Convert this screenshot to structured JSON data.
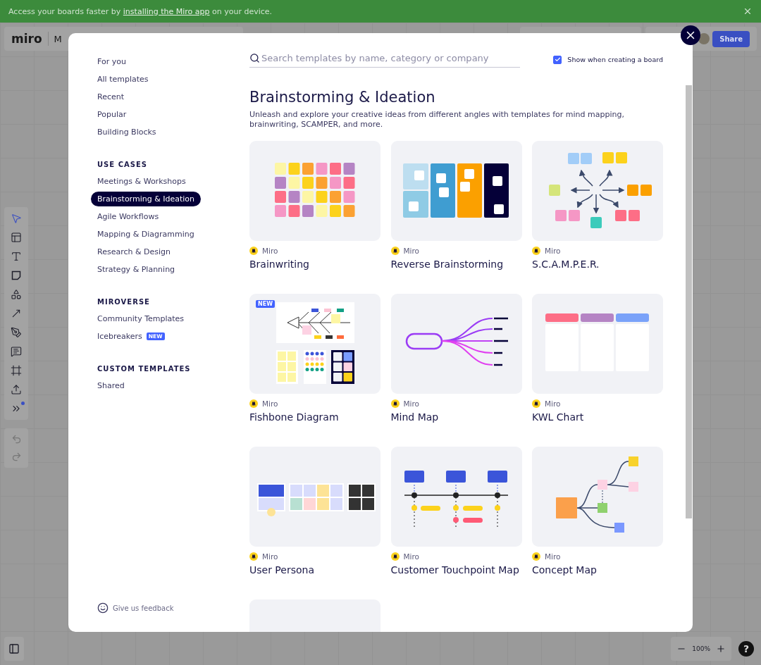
{
  "banner": {
    "text": "Access your boards faster by ",
    "link": "installing the Miro app",
    "text_end": " on your device."
  },
  "board": {
    "logo": "miro",
    "name": "M",
    "share": "Share",
    "zoom": "100%",
    "help": "?",
    "tools": [
      {
        "kind": "select",
        "selected": true
      },
      {
        "kind": "templates",
        "selected": false
      },
      {
        "kind": "text",
        "selected": false
      },
      {
        "kind": "sticky",
        "selected": false
      },
      {
        "kind": "shapes",
        "selected": false
      },
      {
        "kind": "line",
        "selected": false
      },
      {
        "kind": "pen",
        "selected": false
      },
      {
        "kind": "comment",
        "selected": false
      },
      {
        "kind": "frame",
        "selected": false
      },
      {
        "kind": "upload",
        "selected": false
      },
      {
        "kind": "more",
        "selected": false,
        "dot": true
      }
    ]
  },
  "modal": {
    "sidebar": {
      "items": [
        {
          "label": "For you",
          "selected": false
        },
        {
          "label": "All templates",
          "selected": false
        },
        {
          "label": "Recent",
          "selected": false
        },
        {
          "label": "Popular",
          "selected": false
        },
        {
          "label": "Building Blocks",
          "selected": false
        }
      ],
      "sections": [
        {
          "heading": "USE CASES",
          "items": [
            {
              "label": "Meetings & Workshops",
              "selected": false
            },
            {
              "label": "Brainstorming & Ideation",
              "selected": true
            },
            {
              "label": "Agile Workflows",
              "selected": false
            },
            {
              "label": "Mapping & Diagramming",
              "selected": false
            },
            {
              "label": "Research & Design",
              "selected": false
            },
            {
              "label": "Strategy & Planning",
              "selected": false
            }
          ]
        },
        {
          "heading": "MIROVERSE",
          "items": [
            {
              "label": "Community Templates",
              "selected": false
            },
            {
              "label": "Icebreakers",
              "selected": false,
              "badge": "NEW"
            }
          ]
        },
        {
          "heading": "CUSTOM TEMPLATES",
          "items": [
            {
              "label": "Shared",
              "selected": false
            }
          ]
        }
      ],
      "feedback": "Give us feedback"
    },
    "search": {
      "placeholder": "Search templates by name, category or company"
    },
    "show_when_creating": {
      "label": "Show when creating a board",
      "checked": true
    },
    "title": "Brainstorming & Ideation",
    "description": "Unleash and explore your creative ideas from different angles with templates for mind mapping, brainwriting, SCAMPER, and more.",
    "templates": [
      {
        "kind": "grid",
        "author": "Miro",
        "title": "Brainwriting"
      },
      {
        "kind": "columns",
        "author": "Miro",
        "title": "Reverse Brainstorming"
      },
      {
        "kind": "scamper",
        "author": "Miro",
        "title": "S.C.A.M.P.E.R."
      },
      {
        "kind": "fishbone",
        "author": "Miro",
        "title": "Fishbone Diagram",
        "badge": "NEW"
      },
      {
        "kind": "mindmap",
        "author": "Miro",
        "title": "Mind Map"
      },
      {
        "kind": "kwl",
        "author": "Miro",
        "title": "KWL Chart"
      },
      {
        "kind": "persona",
        "author": "Miro",
        "title": "User Persona"
      },
      {
        "kind": "touchpoint",
        "author": "Miro",
        "title": "Customer Touchpoint Map"
      },
      {
        "kind": "concept",
        "author": "Miro",
        "title": "Concept Map"
      }
    ]
  }
}
